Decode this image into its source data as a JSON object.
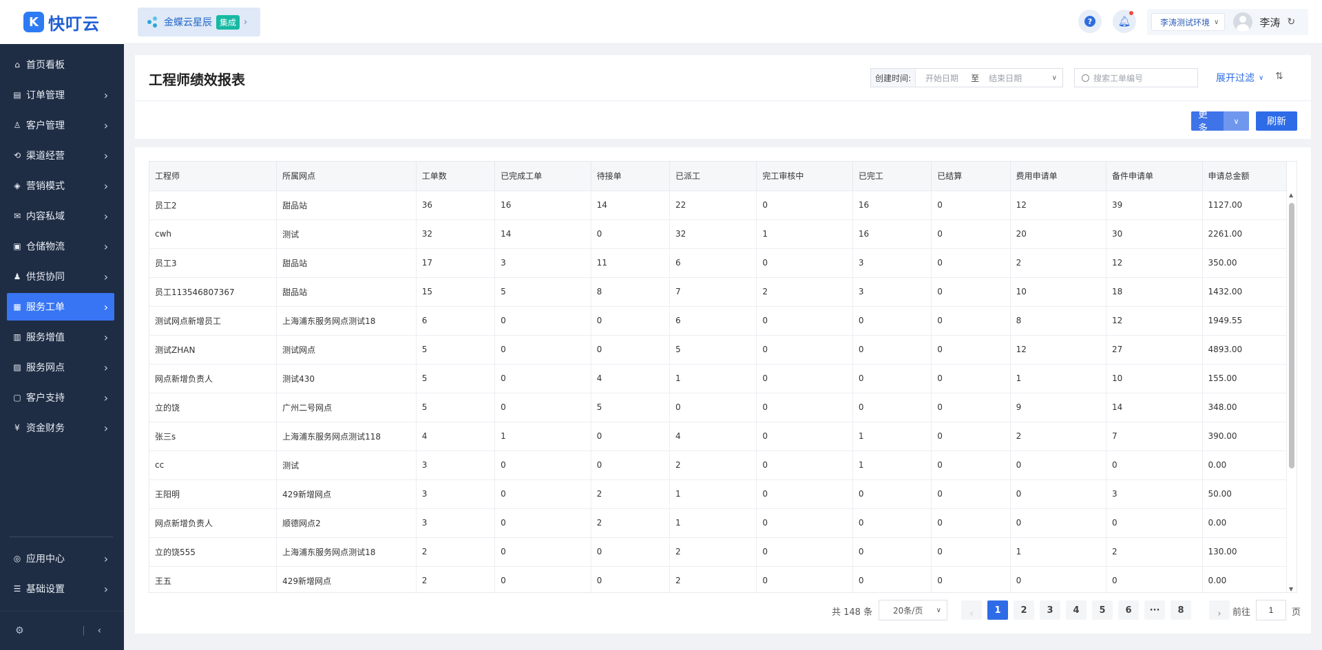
{
  "brand": {
    "name": "快叮云",
    "logo_letter": "K"
  },
  "header": {
    "app_name": "金蝶云星辰",
    "app_badge": "集成",
    "environment": "李涛测试环境",
    "user_name": "李涛",
    "help_icon": "help-icon",
    "bell_icon": "bell-icon"
  },
  "sidebar": {
    "items": [
      {
        "label": "首页看板",
        "icon": "⌂",
        "has_children": false,
        "active": false
      },
      {
        "label": "订单管理",
        "icon": "▤",
        "has_children": true,
        "active": false
      },
      {
        "label": "客户管理",
        "icon": "♙",
        "has_children": true,
        "active": false
      },
      {
        "label": "渠道经营",
        "icon": "⟲",
        "has_children": true,
        "active": false
      },
      {
        "label": "营销模式",
        "icon": "◈",
        "has_children": true,
        "active": false
      },
      {
        "label": "内容私域",
        "icon": "✉",
        "has_children": true,
        "active": false
      },
      {
        "label": "仓储物流",
        "icon": "▣",
        "has_children": true,
        "active": false
      },
      {
        "label": "供货协同",
        "icon": "♟",
        "has_children": true,
        "active": false
      },
      {
        "label": "服务工单",
        "icon": "▦",
        "has_children": true,
        "active": true
      },
      {
        "label": "服务增值",
        "icon": "▥",
        "has_children": true,
        "active": false
      },
      {
        "label": "服务网点",
        "icon": "▨",
        "has_children": true,
        "active": false
      },
      {
        "label": "客户支持",
        "icon": "▢",
        "has_children": true,
        "active": false
      },
      {
        "label": "资金财务",
        "icon": "¥",
        "has_children": true,
        "active": false
      }
    ],
    "bottom_items": [
      {
        "label": "应用中心",
        "icon": "◎",
        "has_children": true
      },
      {
        "label": "基础设置",
        "icon": "☰",
        "has_children": true
      }
    ]
  },
  "page": {
    "title": "工程师绩效报表",
    "filter": {
      "created_label": "创建时间:",
      "start_placeholder": "开始日期",
      "to_label": "至",
      "end_placeholder": "结束日期",
      "search_placeholder": "搜索工单编号",
      "expand_label": "展开过滤"
    },
    "buttons": {
      "more": "更多",
      "refresh": "刷新"
    }
  },
  "table": {
    "columns": [
      "工程师",
      "所属网点",
      "工单数",
      "已完成工单",
      "待接单",
      "已派工",
      "完工审核中",
      "已完工",
      "已结算",
      "费用申请单",
      "备件申请单",
      "申请总金额"
    ],
    "rows": [
      [
        "员工2",
        "甜品站",
        "36",
        "16",
        "14",
        "22",
        "0",
        "16",
        "0",
        "12",
        "39",
        "1127.00"
      ],
      [
        "cwh",
        "测试",
        "32",
        "14",
        "0",
        "32",
        "1",
        "16",
        "0",
        "20",
        "30",
        "2261.00"
      ],
      [
        "员工3",
        "甜品站",
        "17",
        "3",
        "11",
        "6",
        "0",
        "3",
        "0",
        "2",
        "12",
        "350.00"
      ],
      [
        "员工113546807367",
        "甜品站",
        "15",
        "5",
        "8",
        "7",
        "2",
        "3",
        "0",
        "10",
        "18",
        "1432.00"
      ],
      [
        "测试网点新增员工",
        "上海浦东服务网点测试18",
        "6",
        "0",
        "0",
        "6",
        "0",
        "0",
        "0",
        "8",
        "12",
        "1949.55"
      ],
      [
        "测试ZHAN",
        "测试网点",
        "5",
        "0",
        "0",
        "5",
        "0",
        "0",
        "0",
        "12",
        "27",
        "4893.00"
      ],
      [
        "网点新增负责人",
        "测试430",
        "5",
        "0",
        "4",
        "1",
        "0",
        "0",
        "0",
        "1",
        "10",
        "155.00"
      ],
      [
        "立的饶",
        "广州二号网点",
        "5",
        "0",
        "5",
        "0",
        "0",
        "0",
        "0",
        "9",
        "14",
        "348.00"
      ],
      [
        "张三s",
        "上海浦东服务网点测试118",
        "4",
        "1",
        "0",
        "4",
        "0",
        "1",
        "0",
        "2",
        "7",
        "390.00"
      ],
      [
        "cc",
        "测试",
        "3",
        "0",
        "0",
        "2",
        "0",
        "1",
        "0",
        "0",
        "0",
        "0.00"
      ],
      [
        "王阳明",
        "429新增网点",
        "3",
        "0",
        "2",
        "1",
        "0",
        "0",
        "0",
        "0",
        "3",
        "50.00"
      ],
      [
        "网点新增负责人",
        "顺德网点2",
        "3",
        "0",
        "2",
        "1",
        "0",
        "0",
        "0",
        "0",
        "0",
        "0.00"
      ],
      [
        "立的饶555",
        "上海浦东服务网点测试18",
        "2",
        "0",
        "0",
        "2",
        "0",
        "0",
        "0",
        "1",
        "2",
        "130.00"
      ],
      [
        "王五",
        "429新增网点",
        "2",
        "0",
        "0",
        "2",
        "0",
        "0",
        "0",
        "0",
        "0",
        "0.00"
      ]
    ]
  },
  "pagination": {
    "total": "共 148 条",
    "page_size": "20条/页",
    "pages": [
      "1",
      "2",
      "3",
      "4",
      "5",
      "6",
      "···",
      "8"
    ],
    "current": "1",
    "goto_label": "前往",
    "goto_value": "1",
    "goto_suffix": "页"
  }
}
